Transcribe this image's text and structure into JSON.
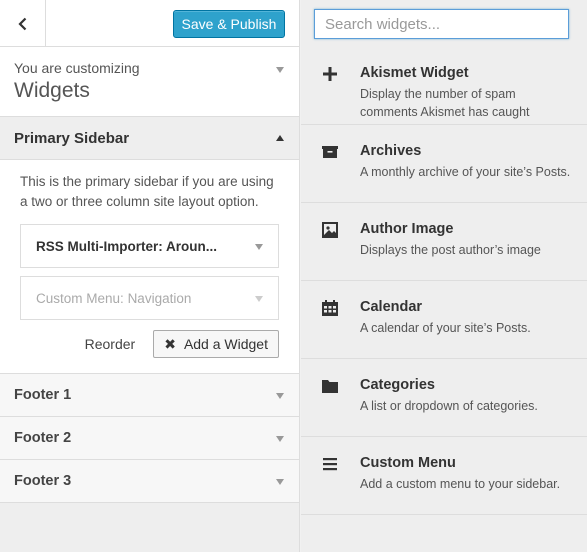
{
  "header": {
    "save_publish_label": "Save & Publish",
    "back_icon": "chevron-left-icon"
  },
  "customizing": {
    "label": "You are customizing",
    "title": "Widgets"
  },
  "primary_sidebar": {
    "title": "Primary Sidebar",
    "description": "This is the primary sidebar if you are using a two or three column site layout option.",
    "widgets": [
      {
        "title": "RSS Multi-Importer: Aroun..."
      },
      {
        "name": "Custom Menu",
        "subtitle": "Navigation"
      }
    ],
    "reorder_label": "Reorder",
    "add_widget_label": "Add a Widget"
  },
  "footers": [
    "Footer 1",
    "Footer 2",
    "Footer 3"
  ],
  "search": {
    "placeholder": "Search widgets..."
  },
  "available_widgets": [
    {
      "icon": "plus-icon",
      "title": "Akismet Widget",
      "description": "Display the number of spam comments Akismet has caught"
    },
    {
      "icon": "archive-icon",
      "title": "Archives",
      "description": "A monthly archive of your site’s Posts."
    },
    {
      "icon": "image-icon",
      "title": "Author Image",
      "description": "Displays the post author’s image"
    },
    {
      "icon": "calendar-icon",
      "title": "Calendar",
      "description": "A calendar of your site’s Posts."
    },
    {
      "icon": "folder-icon",
      "title": "Categories",
      "description": "A list or dropdown of categories."
    },
    {
      "icon": "menu-icon",
      "title": "Custom Menu",
      "description": "Add a custom menu to your sidebar."
    }
  ],
  "colors": {
    "accent": "#2ea2cc",
    "panel_bg": "#eeeeee"
  }
}
